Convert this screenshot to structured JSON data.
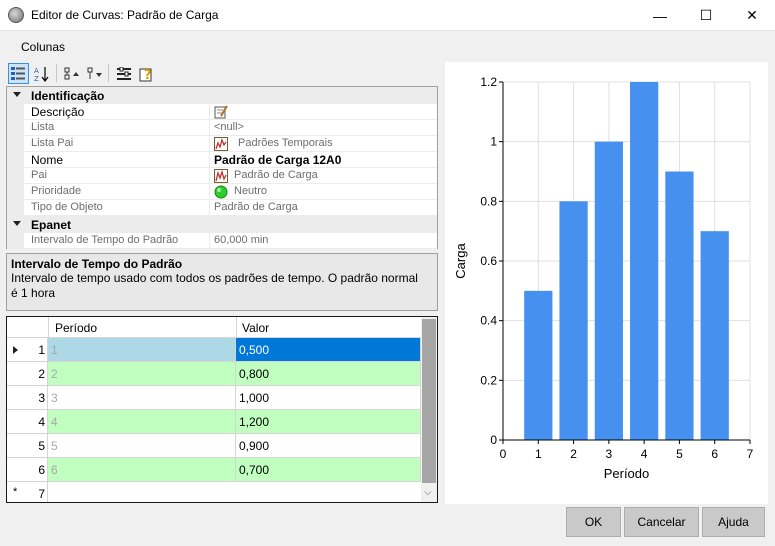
{
  "window": {
    "title": "Editor de Curvas: Padrão de Carga",
    "minimize": "—",
    "maximize": "☐",
    "close": "✕"
  },
  "menu": {
    "columns": "Colunas"
  },
  "toolbar": {
    "icons": [
      "categorized-icon",
      "alphabetical-sort-icon",
      "expand-icon",
      "filter-icon",
      "properties-icon",
      "help-icon"
    ]
  },
  "property_grid": {
    "categories": {
      "identification": "Identificação",
      "epanet": "Epanet"
    },
    "rows": {
      "descricao": {
        "name": "Descrição",
        "value": ""
      },
      "lista": {
        "name": "Lista",
        "value": "<null>"
      },
      "lista_pai": {
        "name": "Lista Pai",
        "value": "Padrões Temporais"
      },
      "nome": {
        "name": "Nome",
        "value": "Padrão de Carga 12A0"
      },
      "pai": {
        "name": "Pai",
        "value": "Padrão de Carga"
      },
      "prioridade": {
        "name": "Prioridade",
        "value": "Neutro"
      },
      "tipo_objeto": {
        "name": "Tipo de Objeto",
        "value": "Padrão de Carga"
      },
      "intervalo": {
        "name": "Intervalo de Tempo do Padrão",
        "value": "60,000 min"
      }
    }
  },
  "help_panel": {
    "title": "Intervalo de Tempo do Padrão",
    "description": "Intervalo de tempo usado com todos os padrões de tempo. O padrão normal é 1 hora"
  },
  "grid": {
    "columns": [
      "Período",
      "Valor"
    ],
    "rows": [
      {
        "num": "1",
        "periodo": "1",
        "valor": "0,500"
      },
      {
        "num": "2",
        "periodo": "2",
        "valor": "0,800"
      },
      {
        "num": "3",
        "periodo": "3",
        "valor": "1,000"
      },
      {
        "num": "4",
        "periodo": "4",
        "valor": "1,200"
      },
      {
        "num": "5",
        "periodo": "5",
        "valor": "0,900"
      },
      {
        "num": "6",
        "periodo": "6",
        "valor": "0,700"
      }
    ],
    "new_row_num": "7",
    "new_row_marker": "*"
  },
  "buttons": {
    "ok": "OK",
    "cancel": "Cancelar",
    "help": "Ajuda"
  },
  "colors": {
    "bar": "#4690f0",
    "selected_row": "#0078d7",
    "alt_row": "#c0ffc0",
    "selected_cell": "#add8e6"
  },
  "chart_data": {
    "type": "bar",
    "x": [
      1,
      2,
      3,
      4,
      5,
      6
    ],
    "values": [
      0.5,
      0.8,
      1.0,
      1.2,
      0.9,
      0.7
    ],
    "xlabel": "Período",
    "ylabel": "Carga",
    "xlim": [
      0,
      7
    ],
    "ylim": [
      0,
      1.2
    ],
    "xticks": [
      "0",
      "1",
      "2",
      "3",
      "4",
      "5",
      "6",
      "7"
    ],
    "yticks": [
      "0",
      "0.2",
      "0.4",
      "0.6",
      "0.8",
      "1",
      "1.2"
    ],
    "grid": true
  }
}
